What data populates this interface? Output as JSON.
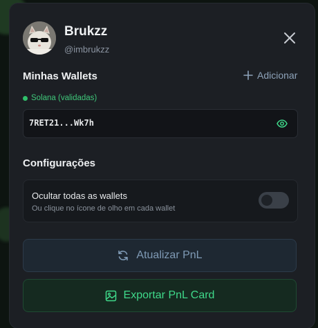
{
  "profile": {
    "name": "Brukzz",
    "handle": "@imbrukzz"
  },
  "wallets": {
    "title": "Minhas Wallets",
    "add_label": "Adicionar",
    "chain_label": "Solana (validadas)",
    "address": "7RET21...Wk7h"
  },
  "settings": {
    "title": "Configurações",
    "hide_all_label": "Ocultar todas as wallets",
    "hide_all_hint": "Ou clique no ícone de olho em cada wallet",
    "hide_all_enabled": false
  },
  "actions": {
    "refresh_label": "Atualizar PnL",
    "export_label": "Exportar PnL Card"
  },
  "colors": {
    "panel": "#1c1f24",
    "accent_green": "#3fd98a",
    "accent_blue": "#7f9ab5"
  },
  "icons": [
    "close-icon",
    "plus-icon",
    "eye-icon",
    "refresh-icon",
    "image-icon"
  ]
}
